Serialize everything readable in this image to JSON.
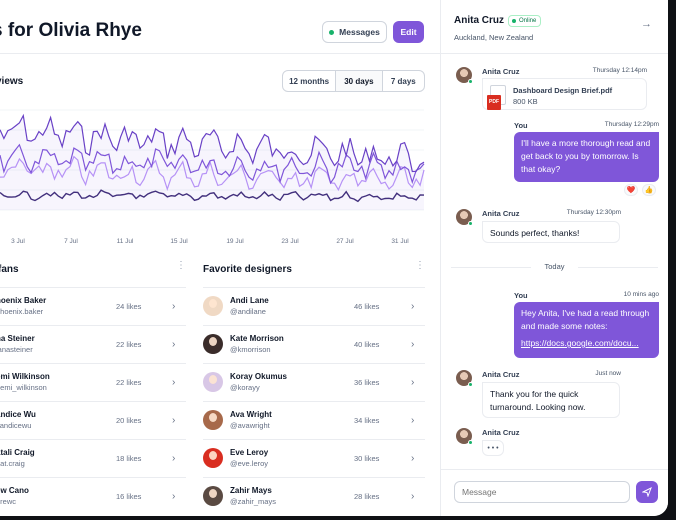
{
  "header": {
    "title": "s for Olivia Rhye",
    "messages_label": "Messages",
    "edit_label": "Edit"
  },
  "views": {
    "title": "views",
    "ranges": [
      "12 months",
      "30 days",
      "7 days"
    ],
    "active_range": "30 days",
    "x_labels": [
      "3 Jul",
      "7 Jul",
      "11 Jul",
      "15 Jul",
      "19 Jul",
      "23 Jul",
      "27 Jul",
      "31 Jul"
    ]
  },
  "fans": {
    "title": "fans",
    "rows": [
      {
        "name": "hoenix Baker",
        "handle": "phoenix.baker",
        "likes": "24 likes"
      },
      {
        "name": "na Steiner",
        "handle": "lanasteiner",
        "likes": "22 likes"
      },
      {
        "name": "emi Wilkinson",
        "handle": "demi_wilkinson",
        "likes": "22 likes"
      },
      {
        "name": "andice Wu",
        "handle": "candicewu",
        "likes": "20 likes"
      },
      {
        "name": "atali Craig",
        "handle": "nat.craig",
        "likes": "18 likes"
      },
      {
        "name": "ew Cano",
        "handle": "drewc",
        "likes": "16 likes"
      }
    ]
  },
  "designers": {
    "title": "Favorite designers",
    "rows": [
      {
        "name": "Andi Lane",
        "handle": "@andilane",
        "likes": "46 likes",
        "color": "#f0d9c4"
      },
      {
        "name": "Kate Morrison",
        "handle": "@kmorrison",
        "likes": "40 likes",
        "color": "#3a2c2a"
      },
      {
        "name": "Koray Okumus",
        "handle": "@korayy",
        "likes": "36 likes",
        "color": "#d8c7e6"
      },
      {
        "name": "Ava Wright",
        "handle": "@avawright",
        "likes": "34 likes",
        "color": "#a7694a"
      },
      {
        "name": "Eve Leroy",
        "handle": "@eve.leroy",
        "likes": "30 likes",
        "color": "#d92d20"
      },
      {
        "name": "Zahir Mays",
        "handle": "@zahir_mays",
        "likes": "28 likes",
        "color": "#5a4a42"
      }
    ]
  },
  "chat": {
    "name": "Anita Cruz",
    "status": "Online",
    "location": "Auckland, New Zealand",
    "messages": [
      {
        "from": "Anita Cruz",
        "time": "Thursday 12:14pm",
        "file_name": "Dashboard Design Brief.pdf",
        "file_size": "800 KB",
        "file_type": "PDF"
      },
      {
        "from": "You",
        "time": "Thursday 12:29pm",
        "text": "I'll have a more thorough read and get back to you by tomorrow. Is that okay?"
      },
      {
        "from": "Anita Cruz",
        "time": "Thursday 12:30pm",
        "text": "Sounds perfect, thanks!"
      },
      {
        "from": "You",
        "time": "10 mins ago",
        "text": "Hey Anita, I've had a read through and made some notes:",
        "link": "https://docs.google.com/docu..."
      },
      {
        "from": "Anita Cruz",
        "time": "Just now",
        "text": "Thank you for the quick turnaround. Looking now."
      },
      {
        "from": "Anita Cruz",
        "typing": "• • •"
      }
    ],
    "reactions": [
      "❤️",
      "👍"
    ],
    "divider": "Today",
    "input_placeholder": "Message"
  },
  "colors": {
    "accent": "#7f56d9",
    "online": "#17b26a"
  }
}
